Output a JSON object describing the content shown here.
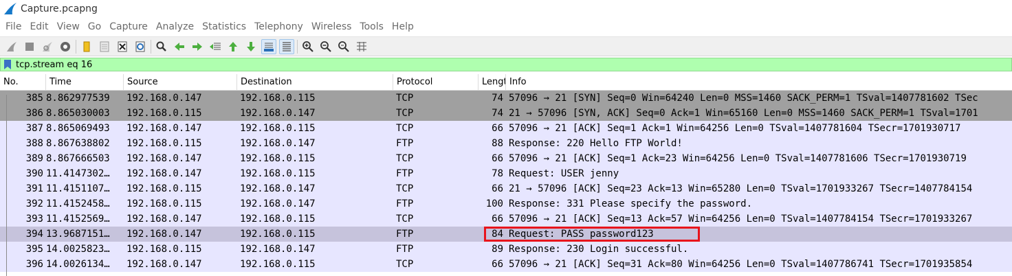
{
  "window": {
    "title": "Capture.pcapng"
  },
  "menu": [
    "File",
    "Edit",
    "View",
    "Go",
    "Capture",
    "Analyze",
    "Statistics",
    "Telephony",
    "Wireless",
    "Tools",
    "Help"
  ],
  "toolbar": {
    "buttons": [
      "start-capture-icon",
      "stop-capture-icon",
      "restart-capture-icon",
      "capture-options-icon",
      "open-file-icon",
      "save-file-icon",
      "close-file-icon",
      "reload-file-icon",
      "find-packet-icon",
      "go-back-icon",
      "go-forward-icon",
      "go-to-packet-icon",
      "go-first-packet-icon",
      "go-last-packet-icon",
      "autoscroll-icon",
      "colorize-icon",
      "zoom-in-icon",
      "zoom-out-icon",
      "normal-size-icon",
      "resize-columns-icon"
    ]
  },
  "filter": {
    "value": "tcp.stream eq 16",
    "bg_color": "#afffaf"
  },
  "columns": {
    "no": "No.",
    "time": "Time",
    "source": "Source",
    "destination": "Destination",
    "protocol": "Protocol",
    "length": "Lengt",
    "info": "Info"
  },
  "packets": [
    {
      "no": "385",
      "time": "8.862977539",
      "src": "192.168.0.147",
      "dst": "192.168.0.115",
      "proto": "TCP",
      "len": "74",
      "info": "57096 → 21 [SYN] Seq=0 Win=64240 Len=0 MSS=1460 SACK_PERM=1 TSval=1407781602 TSec"
    },
    {
      "no": "386",
      "time": "8.865030003",
      "src": "192.168.0.115",
      "dst": "192.168.0.147",
      "proto": "TCP",
      "len": "74",
      "info": "21 → 57096 [SYN, ACK] Seq=0 Ack=1 Win=65160 Len=0 MSS=1460 SACK_PERM=1 TSval=1701"
    },
    {
      "no": "387",
      "time": "8.865069493",
      "src": "192.168.0.147",
      "dst": "192.168.0.115",
      "proto": "TCP",
      "len": "66",
      "info": "57096 → 21 [ACK] Seq=1 Ack=1 Win=64256 Len=0 TSval=1407781604 TSecr=1701930717"
    },
    {
      "no": "388",
      "time": "8.867638802",
      "src": "192.168.0.115",
      "dst": "192.168.0.147",
      "proto": "FTP",
      "len": "88",
      "info": "Response: 220 Hello FTP World!"
    },
    {
      "no": "389",
      "time": "8.867666503",
      "src": "192.168.0.147",
      "dst": "192.168.0.115",
      "proto": "TCP",
      "len": "66",
      "info": "57096 → 21 [ACK] Seq=1 Ack=23 Win=64256 Len=0 TSval=1407781606 TSecr=1701930719"
    },
    {
      "no": "390",
      "time": "11.4147302…",
      "src": "192.168.0.147",
      "dst": "192.168.0.115",
      "proto": "FTP",
      "len": "78",
      "info": "Request: USER jenny"
    },
    {
      "no": "391",
      "time": "11.4151107…",
      "src": "192.168.0.115",
      "dst": "192.168.0.147",
      "proto": "TCP",
      "len": "66",
      "info": "21 → 57096 [ACK] Seq=23 Ack=13 Win=65280 Len=0 TSval=1701933267 TSecr=1407784154"
    },
    {
      "no": "392",
      "time": "11.4152458…",
      "src": "192.168.0.115",
      "dst": "192.168.0.147",
      "proto": "FTP",
      "len": "100",
      "info": "Response: 331 Please specify the password."
    },
    {
      "no": "393",
      "time": "11.4152569…",
      "src": "192.168.0.147",
      "dst": "192.168.0.115",
      "proto": "TCP",
      "len": "66",
      "info": "57096 → 21 [ACK] Seq=13 Ack=57 Win=64256 Len=0 TSval=1407784154 TSecr=1701933267"
    },
    {
      "no": "394",
      "time": "13.9687151…",
      "src": "192.168.0.147",
      "dst": "192.168.0.115",
      "proto": "FTP",
      "len": "84",
      "info": "Request: PASS password123"
    },
    {
      "no": "395",
      "time": "14.0025823…",
      "src": "192.168.0.115",
      "dst": "192.168.0.147",
      "proto": "FTP",
      "len": "89",
      "info": "Response: 230 Login successful."
    },
    {
      "no": "396",
      "time": "14.0026134…",
      "src": "192.168.0.147",
      "dst": "192.168.0.115",
      "proto": "TCP",
      "len": "66",
      "info": "57096 → 21 [ACK] Seq=31 Ack=80 Win=64256 Len=0 TSval=1407786741 TSecr=1701935854"
    }
  ],
  "row_styles": [
    "gray",
    "gray",
    "lav",
    "lav",
    "lav",
    "lav",
    "lav",
    "lav",
    "lav",
    "sel",
    "lav",
    "lav"
  ],
  "colors": {
    "syn_row": "#a0a0a0",
    "tcp_row": "#e7e6ff",
    "selected_row": "#c6c3dc",
    "annotation_box": "#e8141c"
  }
}
